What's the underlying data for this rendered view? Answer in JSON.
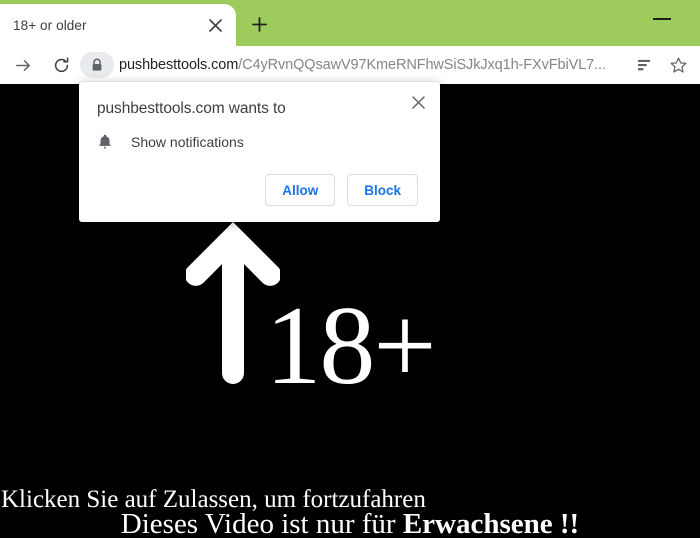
{
  "browser": {
    "theme_color": "#9ecc5c",
    "tab": {
      "title": "18+ or older",
      "close_icon": "close-icon"
    },
    "new_tab_label": "+",
    "window_controls": {
      "minimize_label": "Minimize"
    },
    "toolbar": {
      "forward_icon": "forward-arrow-icon",
      "reload_icon": "reload-icon",
      "lock_icon": "lock-icon",
      "url_host": "pushbesttools.com",
      "url_path": "/C4yRvnQQsawV97KmeRNFhwSiSJkJxq1h-FXvFbiVL7...",
      "menu_icon": "reading-list-icon",
      "bookmark_icon": "star-icon"
    }
  },
  "permission_dialog": {
    "title": "pushbesttools.com wants to",
    "request_icon": "bell-icon",
    "request_label": "Show notifications",
    "allow_label": "Allow",
    "block_label": "Block",
    "close_icon": "close-icon",
    "accent_color": "#1a73e8"
  },
  "page": {
    "background_color": "#000000",
    "headline": "18+",
    "arrow_icon": "up-arrow-icon",
    "caption_line1": "Klicken Sie auf Zulassen, um fortzufahren",
    "caption_line2_plain": "Dieses Video ist nur für ",
    "caption_line2_bold": "Erwachsene !!"
  }
}
